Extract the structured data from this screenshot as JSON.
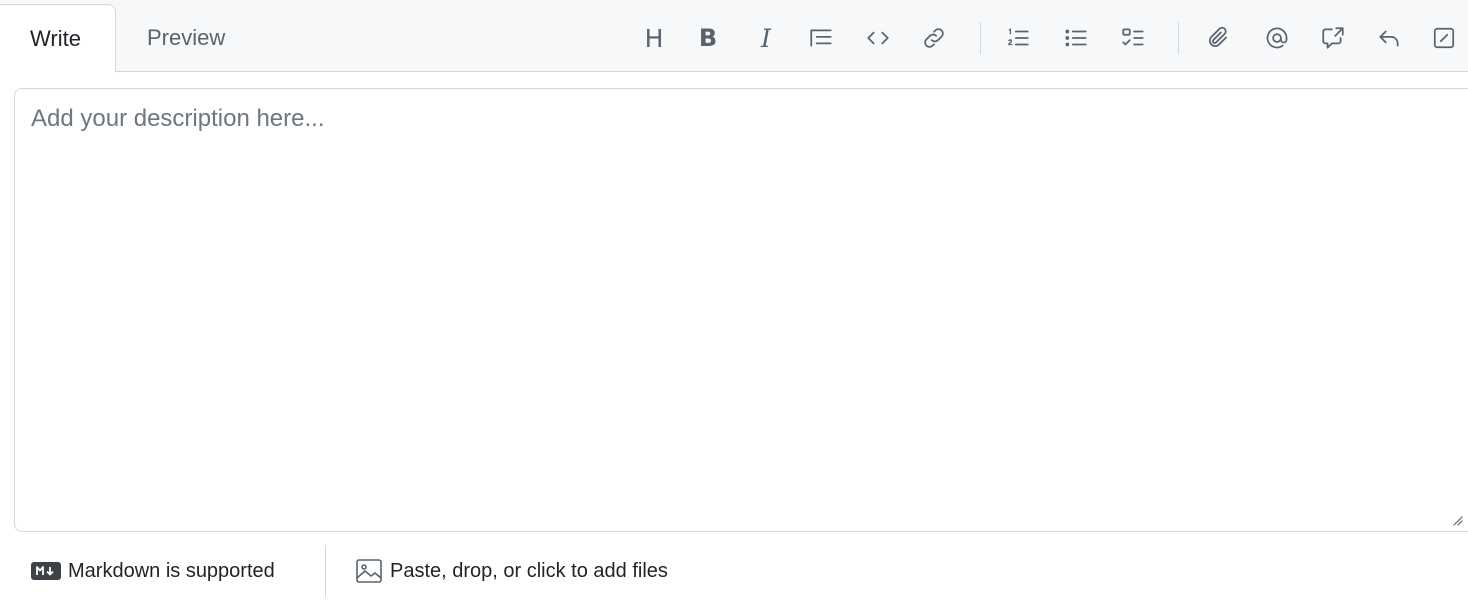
{
  "tabs": {
    "write": "Write",
    "preview": "Preview"
  },
  "toolbar": {
    "heading": "H",
    "bold": "B",
    "italic": "I",
    "buttons": [
      "heading-icon",
      "bold-icon",
      "italic-icon",
      "quote-icon",
      "code-icon",
      "link-icon",
      "numbered-list-icon",
      "unordered-list-icon",
      "task-list-icon",
      "attach-icon",
      "mention-icon",
      "reference-icon",
      "reply-icon",
      "slash-command-icon"
    ]
  },
  "editor": {
    "placeholder": "Add your description here...",
    "value": ""
  },
  "footer": {
    "markdown_label": "Markdown is supported",
    "files_label": "Paste, drop, or click to add files"
  },
  "colors": {
    "header_bg": "#f6f8fa",
    "border": "#d0d7de",
    "icon": "#59636e",
    "text": "#1f2328"
  }
}
